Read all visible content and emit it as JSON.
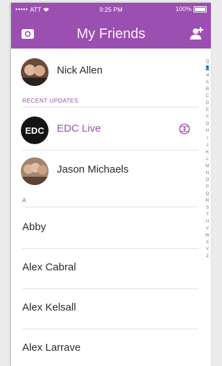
{
  "status_bar": {
    "carrier": "ATT",
    "time": "9:25 PM",
    "battery": "100%"
  },
  "header": {
    "title": "My Friends",
    "left_icon": "camera-icon",
    "right_icon": "add-friend-icon"
  },
  "best_friend": {
    "name": "Nick Allen"
  },
  "recent_updates": {
    "label": "RECENT UPDATES",
    "items": [
      {
        "name": "EDC Live",
        "logo_text": "EDC",
        "icon": "story-sync-icon"
      },
      {
        "name": "Jason Michaels"
      }
    ]
  },
  "section_a": {
    "label": "A",
    "items": [
      {
        "name": "Abby"
      },
      {
        "name": "Alex Cabral"
      },
      {
        "name": "Alex Kelsall"
      },
      {
        "name": "Alex Larrave"
      }
    ]
  },
  "index": [
    "Q",
    "👤",
    "➜",
    "A",
    "B",
    "C",
    "D",
    "E",
    "F",
    "G",
    "H",
    "I",
    "J",
    "K",
    "L",
    "M",
    "N",
    "O",
    "P",
    "Q",
    "R",
    "S",
    "T",
    "U",
    "V",
    "W",
    "X",
    "Y",
    "Z"
  ],
  "colors": {
    "accent": "#9b4fb0"
  }
}
